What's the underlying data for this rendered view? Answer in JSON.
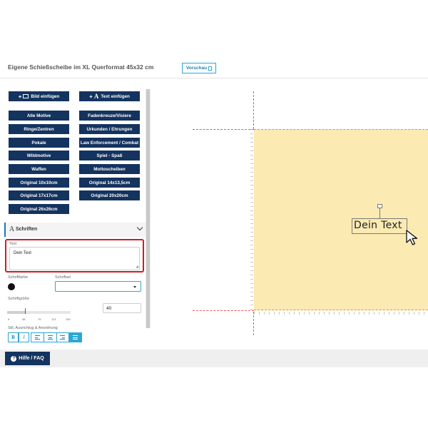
{
  "header": {
    "title": "Eigene Schießscheibe im XL Querformat 45x32 cm",
    "preview_label": "Vorschau"
  },
  "insert_buttons": {
    "image_label": "Bild einfügen",
    "text_label": "Text einfügen"
  },
  "categories": [
    "Alle Motive",
    "Fadenkreuze/Visiere",
    "Ringe/Zentren",
    "Urkunden / Ehrungen",
    "Pokale",
    "Law Enforcement / Combat",
    "Wildmotive",
    "Spiel - Spaß",
    "Waffen",
    "Mottoscheiben",
    "Original 10x10cm",
    "Original 14x13,5cm",
    "Original 17x17cm",
    "Original 20x20cm",
    "Original 26x26cm"
  ],
  "fonts_section": {
    "title": "Schriften",
    "text_label": "Text",
    "text_value": "Dein Text",
    "color_label": "Schriftfarbe",
    "font_label": "Schriftart",
    "font_value": "",
    "size_label": "Schriftgröße",
    "size_value": "40",
    "size_slider_fraction": 0.28,
    "slider_ticks": [
      "6",
      "38",
      "75",
      "113",
      "150"
    ],
    "style_label": "Stil, Ausrichtug & Anordnung",
    "bold_label": "B",
    "italic_label": "I"
  },
  "footer": {
    "help_label": "Hilfe / FAQ"
  },
  "canvas": {
    "text_object": "Dein Text"
  },
  "colors": {
    "primary_dark": "#14335e",
    "accent_blue": "#2aa7d6",
    "highlight_red": "#d01b25",
    "target_fill": "#fbeab2",
    "text_color_swatch": "#111111"
  }
}
